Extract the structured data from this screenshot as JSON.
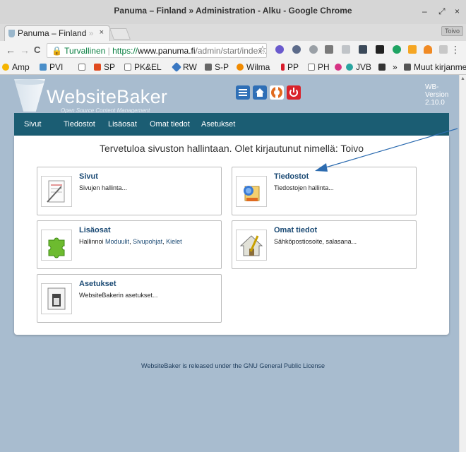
{
  "window": {
    "title": "Panuma – Finland » Administration - Alku - Google Chrome",
    "minimize": "–",
    "restore": "⤢",
    "close": "×"
  },
  "tab": {
    "title": "Panuma – Finland",
    "title_fade": "»",
    "close": "×",
    "profile": "Toivo"
  },
  "toolbar": {
    "back": "←",
    "forward": "→",
    "reload": "C",
    "secure_label": "Turvallinen",
    "url_scheme": "https://",
    "url_host": "www.panuma.fi",
    "url_path": "/admin/start/index...",
    "star": "☆",
    "menu": "⋮"
  },
  "bookmarks": [
    {
      "label": "Amp",
      "color": "#f5b400"
    },
    {
      "label": "PVI",
      "color": "#4a8ec9"
    },
    {
      "label": "",
      "color": "#ffffff"
    },
    {
      "label": "SP",
      "color": "#e04a1f"
    },
    {
      "label": "PK&EL",
      "color": "#ffffff"
    },
    {
      "label": "RW",
      "color": "#3a78c2"
    },
    {
      "label": "S-P",
      "color": "#666666"
    },
    {
      "label": "Wilma",
      "color": "#f08a00"
    },
    {
      "label": "PP",
      "color": "#d81b2a"
    },
    {
      "label": "PH",
      "color": "#ffffff"
    },
    {
      "label": "JVB",
      "color": "#2aa5a0"
    },
    {
      "label": "»",
      "color": ""
    },
    {
      "label": "Muut kirjanmerkit",
      "color": "#555555"
    }
  ],
  "header": {
    "logo": "WebsiteBaker",
    "logo_sub": "Open Source Content Management",
    "version_line1": "WB-",
    "version_line2": "Version",
    "version_line3": "2.10.0",
    "icon_colors": [
      "#2f6fb6",
      "#2f6fb6",
      "#e06a1f",
      "#d9232b"
    ]
  },
  "nav": {
    "items": [
      "Sivut",
      "Tiedostot",
      "Lisäosat",
      "Omat tiedot",
      "Asetukset"
    ]
  },
  "main": {
    "welcome": "Tervetuloa sivuston hallintaan. Olet kirjautunut nimellä: Toivo",
    "cards": [
      {
        "title": "Sivut",
        "desc": "Sivujen hallinta..."
      },
      {
        "title": "Tiedostot",
        "desc": "Tiedostojen hallinta..."
      },
      {
        "title": "Lisäosat",
        "desc_prefix": "Hallinnoi ",
        "links": [
          "Moduulit",
          "Sivupohjat",
          "Kielet"
        ],
        "sep": ", "
      },
      {
        "title": "Omat tiedot",
        "desc": "Sähköpostiosoite, salasana..."
      },
      {
        "title": "Asetukset",
        "desc": "WebsiteBakerin asetukset..."
      }
    ]
  },
  "footer": {
    "prefix": "WebsiteBaker",
    "middle": " is released under the ",
    "link": "GNU General Public License"
  }
}
